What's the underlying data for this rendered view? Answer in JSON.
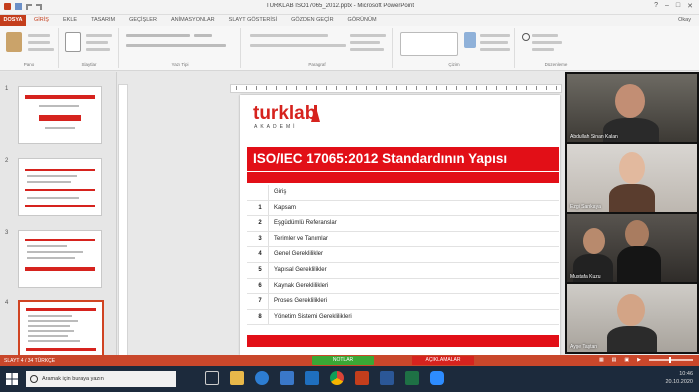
{
  "window": {
    "title": "TURKLAB ISO17065_2012.pptx - Microsoft PowerPoint",
    "user": "Okay"
  },
  "ribbon": {
    "file_tab": "DOSYA",
    "tabs": [
      "GİRİŞ",
      "EKLE",
      "TASARIM",
      "GEÇİŞLER",
      "ANİMASYONLAR",
      "SLAYT GÖSTERİSİ",
      "GÖZDEN GEÇİR",
      "GÖRÜNÜM"
    ],
    "groups": [
      "Pano",
      "Slaytlar",
      "Yazı Tipi",
      "Paragraf",
      "Çizim",
      "Düzenleme"
    ]
  },
  "thumbnails": [
    {
      "num": "1"
    },
    {
      "num": "2"
    },
    {
      "num": "3"
    },
    {
      "num": "4"
    }
  ],
  "slide": {
    "brand": "turklab",
    "brand_sub": "AKADEMİ",
    "title": "ISO/IEC 17065:2012 Standardının Yapısı",
    "toc": [
      {
        "num": "",
        "text": "Giriş"
      },
      {
        "num": "1",
        "text": "Kapsam"
      },
      {
        "num": "2",
        "text": "Eşgüdümlü Referanslar"
      },
      {
        "num": "3",
        "text": "Terimler ve Tanımlar"
      },
      {
        "num": "4",
        "text": "Genel Gereklilikler"
      },
      {
        "num": "5",
        "text": "Yapısal Gereklilikler"
      },
      {
        "num": "6",
        "text": "Kaynak Gereklilikleri"
      },
      {
        "num": "7",
        "text": "Proses Gereklilikleri"
      },
      {
        "num": "8",
        "text": "Yönetim Sistemi Gereklilikleri"
      }
    ]
  },
  "videos": [
    {
      "name": "Abdullah Sinan Kalan"
    },
    {
      "name": "Ezgi Sarıkaya"
    },
    {
      "name": "Mustafa Kuzu"
    },
    {
      "name": "Ayşe Taştan"
    }
  ],
  "statusbar": {
    "left": "SLAYT 4 / 34    TÜRKÇE",
    "notes": "NOTLAR",
    "share": "AÇIKLAMALAR"
  },
  "taskbar": {
    "search_placeholder": "Aramak için buraya yazın",
    "time": "10:46",
    "date": "20.10.2020"
  },
  "colors": {
    "accent": "#d6231e",
    "ribbon_accent": "#c43e1c",
    "status_green": "#3aa835"
  }
}
